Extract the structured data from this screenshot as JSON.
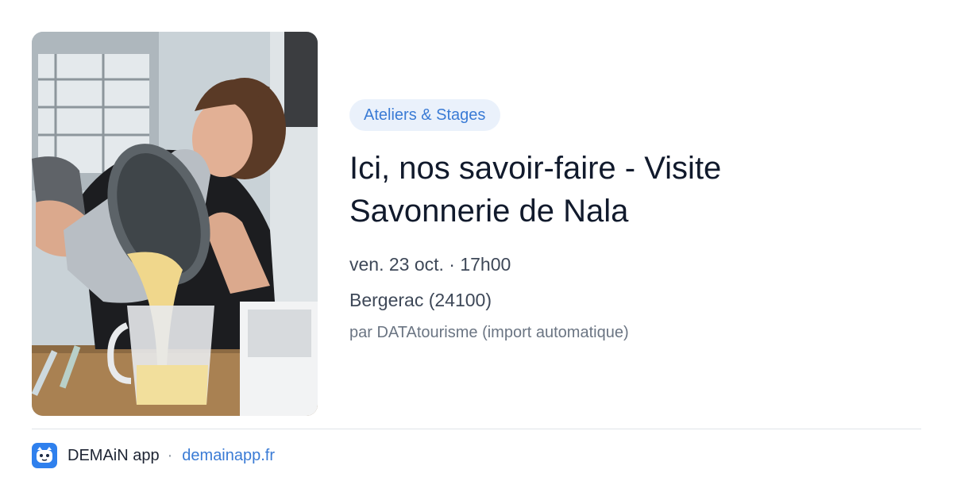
{
  "event": {
    "category": "Ateliers & Stages",
    "title": "Ici, nos savoir-faire - Visite Savonnerie de Nala",
    "date_time": "ven. 23 oct. · 17h00",
    "location": "Bergerac (24100)",
    "source": "par DATAtourisme (import automatique)"
  },
  "footer": {
    "app_name": "DEMAiN app",
    "separator": "·",
    "domain": "demainapp.fr"
  },
  "colors": {
    "accent": "#3a7bd5",
    "chip_background": "#eaf1fb",
    "title": "#111a2c",
    "body_text": "#3e4858",
    "muted": "#6b7583"
  },
  "icons": {
    "app": "demain-app-icon"
  }
}
